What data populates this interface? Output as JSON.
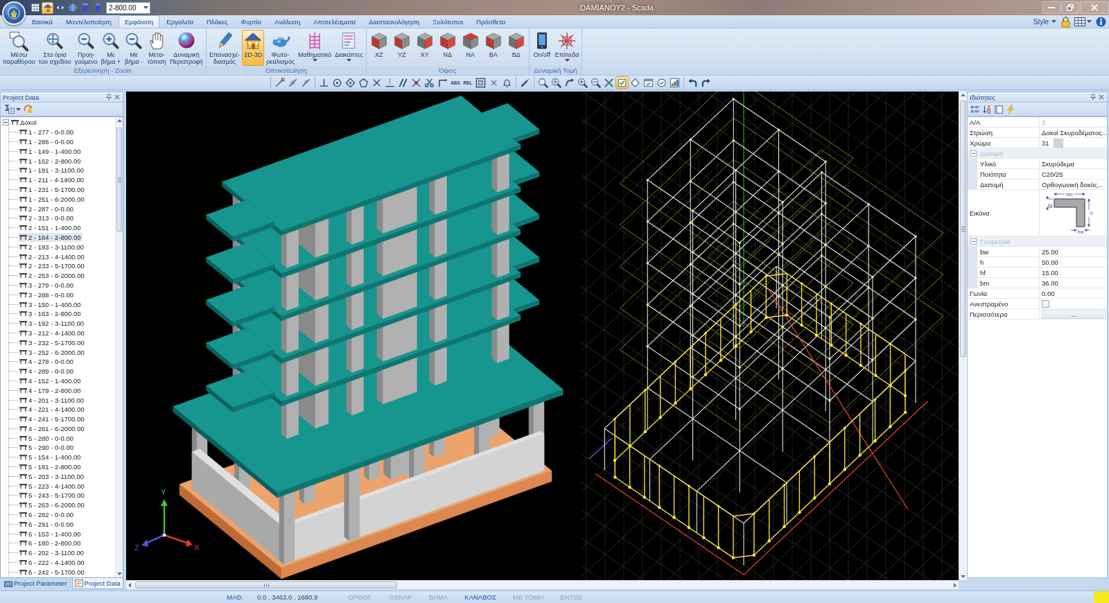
{
  "title_bar": {
    "quick_access": [
      {
        "on": false
      },
      {
        "on": true
      },
      {
        "on": false
      },
      {
        "on": false
      },
      {
        "on": false
      },
      {
        "on": false
      }
    ],
    "level_combo": "2-800.00",
    "title": "DAMIANOY2 - Scada"
  },
  "ribbon_tabs": [
    {
      "label": "Βασικά",
      "selected": false
    },
    {
      "label": "Μοντελοποίηση",
      "selected": false
    },
    {
      "label": "Εμφάνιση",
      "selected": true
    },
    {
      "label": "Εργαλεία",
      "selected": false
    },
    {
      "label": "Πλάκες",
      "selected": false
    },
    {
      "label": "Φορτία",
      "selected": false
    },
    {
      "label": "Ανάλυση",
      "selected": false
    },
    {
      "label": "Αποτελέσματα",
      "selected": false
    },
    {
      "label": "Διαστασιολόγηση",
      "selected": false
    },
    {
      "label": "Ξυλότυποι",
      "selected": false
    },
    {
      "label": "Πρόσθετα",
      "selected": false
    }
  ],
  "ribbon_right": {
    "style_label": "Style"
  },
  "ribbon_groups": [
    {
      "title": "Εξερεύνηση - Zoom",
      "buttons": [
        {
          "label": "Μέσω\nπαραθύρου",
          "selected": false,
          "menu": false
        },
        {
          "label": "Στα όρια\nτου σχεδίου",
          "selected": false,
          "menu": false
        },
        {
          "label": "Προη-\nγούμενο",
          "selected": false,
          "menu": false
        },
        {
          "label": "Με\nβήμα +",
          "selected": false,
          "menu": false
        },
        {
          "label": "Με\nβήμα -",
          "selected": false,
          "menu": false
        },
        {
          "label": "Μετα-\nτόπιση",
          "selected": false,
          "menu": false
        },
        {
          "label": "Δυναμική\nΠεριστροφή",
          "selected": false,
          "menu": false
        }
      ]
    },
    {
      "title": "Οπτικοποίηση",
      "buttons": [
        {
          "label": "Επανασχε-\nδιασμός",
          "selected": false,
          "menu": false
        },
        {
          "label": "2D-3D",
          "selected": true,
          "menu": false
        },
        {
          "label": "Φωτο-\nρεαλισμός",
          "selected": false,
          "menu": false
        },
        {
          "label": "Μαθηματικό",
          "selected": false,
          "menu": true
        },
        {
          "label": "Διακόπτες",
          "selected": false,
          "menu": true
        }
      ]
    },
    {
      "title": "Όψεις",
      "buttons": [
        {
          "label": "XZ",
          "selected": false,
          "menu": false
        },
        {
          "label": "YZ",
          "selected": false,
          "menu": false
        },
        {
          "label": "XY",
          "selected": false,
          "menu": false
        },
        {
          "label": "ΝΔ",
          "selected": false,
          "menu": false
        },
        {
          "label": "ΝΑ",
          "selected": false,
          "menu": false
        },
        {
          "label": "ΒΑ",
          "selected": false,
          "menu": false
        },
        {
          "label": "ΒΔ",
          "selected": false,
          "menu": false
        }
      ]
    },
    {
      "title": "Δυναμική Τομή",
      "buttons": [
        {
          "label": "On/off",
          "selected": false,
          "menu": false
        },
        {
          "label": "Επίπεδα",
          "selected": false,
          "menu": true
        }
      ]
    }
  ],
  "toolbar": {
    "groups": [
      [
        {
          "kind": "icon",
          "on": false
        },
        {
          "kind": "icon",
          "on": false
        },
        {
          "kind": "icon",
          "on": false
        }
      ],
      [
        {
          "kind": "icon",
          "on": false
        },
        {
          "kind": "icon",
          "on": false
        },
        {
          "kind": "icon",
          "on": false
        },
        {
          "kind": "icon",
          "on": false
        },
        {
          "kind": "icon",
          "on": false
        },
        {
          "kind": "icon",
          "on": false
        },
        {
          "kind": "icon",
          "on": false
        },
        {
          "kind": "icon",
          "on": false
        },
        {
          "kind": "icon",
          "on": false
        },
        {
          "kind": "icon",
          "on": false
        },
        {
          "kind": "text",
          "label": "ABS",
          "on": false
        },
        {
          "kind": "text",
          "label": "REL",
          "on": false
        },
        {
          "kind": "icon",
          "on": false
        },
        {
          "kind": "icon",
          "on": false
        },
        {
          "kind": "icon",
          "on": false
        }
      ],
      [
        {
          "kind": "icon",
          "on": false
        }
      ],
      [
        {
          "kind": "icon",
          "on": false
        },
        {
          "kind": "icon",
          "on": false
        },
        {
          "kind": "icon",
          "on": false
        },
        {
          "kind": "icon",
          "on": false
        },
        {
          "kind": "icon",
          "on": false
        },
        {
          "kind": "icon",
          "on": false
        },
        {
          "kind": "icon",
          "on": true
        },
        {
          "kind": "icon",
          "on": false
        },
        {
          "kind": "icon",
          "on": false
        },
        {
          "kind": "icon",
          "on": false
        },
        {
          "kind": "icon",
          "on": false
        }
      ],
      [
        {
          "kind": "icon",
          "on": false
        },
        {
          "kind": "icon",
          "on": false
        }
      ]
    ]
  },
  "project_data": {
    "title": "Project Data",
    "tree": [
      {
        "label": "Δοκοί",
        "expanded": true,
        "children": [
          {
            "label": "1 - 277 - 0-0.00",
            "selected": false
          },
          {
            "label": "1 - 286 - 0-0.00",
            "selected": false
          },
          {
            "label": "1 - 149 - 1-400.00",
            "selected": false
          },
          {
            "label": "1 - 162 - 2-800.00",
            "selected": false
          },
          {
            "label": "1 - 191 - 3-1100.00",
            "selected": false
          },
          {
            "label": "1 - 211 - 4-1400.00",
            "selected": false
          },
          {
            "label": "1 - 231 - 5-1700.00",
            "selected": false
          },
          {
            "label": "1 - 251 - 6-2000.00",
            "selected": false
          },
          {
            "label": "2 - 287 - 0-0.00",
            "selected": false
          },
          {
            "label": "2 - 313 - 0-0.00",
            "selected": false
          },
          {
            "label": "2 - 151 - 1-400.00",
            "selected": false
          },
          {
            "label": "2 - 164 - 2-800.00",
            "selected": true
          },
          {
            "label": "2 - 193 - 3-1100.00",
            "selected": false
          },
          {
            "label": "2 - 213 - 4-1400.00",
            "selected": false
          },
          {
            "label": "2 - 233 - 5-1700.00",
            "selected": false
          },
          {
            "label": "2 - 253 - 6-2000.00",
            "selected": false
          },
          {
            "label": "3 - 279 - 0-0.00",
            "selected": false
          },
          {
            "label": "3 - 288 - 0-0.00",
            "selected": false
          },
          {
            "label": "3 - 150 - 1-400.00",
            "selected": false
          },
          {
            "label": "3 - 163 - 2-800.00",
            "selected": false
          },
          {
            "label": "3 - 192 - 3-1100.00",
            "selected": false
          },
          {
            "label": "3 - 212 - 4-1400.00",
            "selected": false
          },
          {
            "label": "3 - 232 - 5-1700.00",
            "selected": false
          },
          {
            "label": "3 - 252 - 6-2000.00",
            "selected": false
          },
          {
            "label": "4 - 278 - 0-0.00",
            "selected": false
          },
          {
            "label": "4 - 289 - 0-0.00",
            "selected": false
          },
          {
            "label": "4 - 152 - 1-400.00",
            "selected": false
          },
          {
            "label": "4 - 179 - 2-800.00",
            "selected": false
          },
          {
            "label": "4 - 201 - 3-1100.00",
            "selected": false
          },
          {
            "label": "4 - 221 - 4-1400.00",
            "selected": false
          },
          {
            "label": "4 - 241 - 5-1700.00",
            "selected": false
          },
          {
            "label": "4 - 261 - 6-2000.00",
            "selected": false
          },
          {
            "label": "5 - 280 - 0-0.00",
            "selected": false
          },
          {
            "label": "5 - 290 - 0-0.00",
            "selected": false
          },
          {
            "label": "5 - 154 - 1-400.00",
            "selected": false
          },
          {
            "label": "5 - 181 - 2-800.00",
            "selected": false
          },
          {
            "label": "5 - 203 - 3-1100.00",
            "selected": false
          },
          {
            "label": "5 - 223 - 4-1400.00",
            "selected": false
          },
          {
            "label": "5 - 243 - 5-1700.00",
            "selected": false
          },
          {
            "label": "5 - 263 - 6-2000.00",
            "selected": false
          },
          {
            "label": "6 - 282 - 0-0.00",
            "selected": false
          },
          {
            "label": "6 - 291 - 0-0.00",
            "selected": false
          },
          {
            "label": "6 - 153 - 1-400.00",
            "selected": false
          },
          {
            "label": "6 - 180 - 2-800.00",
            "selected": false
          },
          {
            "label": "6 - 202 - 3-1100.00",
            "selected": false
          },
          {
            "label": "6 - 222 - 4-1400.00",
            "selected": false
          },
          {
            "label": "6 - 242 - 5-1700.00",
            "selected": false
          }
        ]
      }
    ]
  },
  "left_panel_tabs": [
    {
      "label": "Project Parameter",
      "selected": false
    },
    {
      "label": "Project Data",
      "selected": true
    }
  ],
  "viewport": {
    "axis_labels": [
      "Y",
      "Z",
      "X"
    ]
  },
  "properties": {
    "title": "Ιδιότητες",
    "rows": [
      {
        "kind": "value",
        "label": "A/A",
        "value": "2",
        "disabled": true
      },
      {
        "kind": "value",
        "label": "Στρώση",
        "value": "Δοκοί Σκυροδέματος...",
        "disabled": false
      },
      {
        "kind": "color",
        "label": "Χρώμα",
        "value": "31",
        "color": "#d4d4d4"
      },
      {
        "kind": "section",
        "label": "Διατομή",
        "expanded": true,
        "children": [
          {
            "kind": "value",
            "label": "Υλικό",
            "value": "Σκυρόδεμα",
            "disabled": false
          },
          {
            "kind": "value",
            "label": "Ποιότητα",
            "value": "C20/25",
            "disabled": false
          },
          {
            "kind": "value",
            "label": "Διατομή",
            "value": "Ορθογωνική δοκός...",
            "disabled": false
          }
        ]
      },
      {
        "kind": "image",
        "label": "Εικόνα",
        "dimension_labels": [
          "bm",
          "hf",
          "h",
          "bw"
        ]
      },
      {
        "kind": "section",
        "label": "Γεωμετρία",
        "expanded": true,
        "children": [
          {
            "kind": "value",
            "label": "bw",
            "value": "25.00",
            "disabled": false
          },
          {
            "kind": "value",
            "label": "h",
            "value": "50.00",
            "disabled": false
          },
          {
            "kind": "value",
            "label": "hf",
            "value": "15.00",
            "disabled": false
          },
          {
            "kind": "value",
            "label": "bm",
            "value": "36.00",
            "disabled": false
          }
        ]
      },
      {
        "kind": "value",
        "label": "Γωνία",
        "value": "0.00",
        "disabled": false
      },
      {
        "kind": "checkbox",
        "label": "Ανεστραμένο",
        "checked": false
      },
      {
        "kind": "button",
        "label": "Περισσότερα",
        "value": "..."
      }
    ]
  },
  "status_bar": {
    "items": [
      {
        "kind": "toggle",
        "label": "ΜΑΘ.",
        "on": true
      },
      {
        "kind": "readout",
        "label": "0.0 , 3463.0 , 1680.9"
      },
      {
        "kind": "toggle",
        "label": "ΟΡΘΟΓ.",
        "on": false
      },
      {
        "kind": "toggle",
        "label": "OSNAP",
        "on": false
      },
      {
        "kind": "toggle",
        "label": "ΒΗΜΑ",
        "on": false
      },
      {
        "kind": "toggle",
        "label": "ΚΑΝΑΒΟΣ",
        "on": true
      },
      {
        "kind": "toggle",
        "label": "ΜΕ ΤΟΜΗ",
        "on": false
      },
      {
        "kind": "toggle",
        "label": "ΕΝΤΟΣ",
        "on": false
      }
    ]
  }
}
